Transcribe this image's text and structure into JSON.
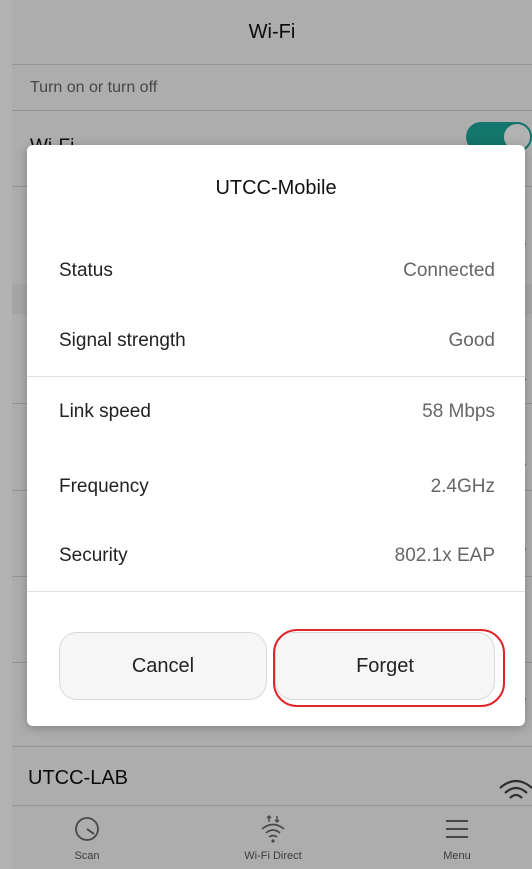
{
  "header": {
    "title": "Wi-Fi"
  },
  "section": {
    "label": "Turn on or turn off"
  },
  "wifi_toggle": {
    "label": "Wi-Fi",
    "state": "on",
    "accent_color": "#1ea89b"
  },
  "networks": [
    {
      "name": "UTCC-LAB",
      "icon": "wifi-signal-icon"
    }
  ],
  "dialog": {
    "title": "UTCC-Mobile",
    "rows": [
      {
        "label": "Status",
        "value": "Connected"
      },
      {
        "label": "Signal strength",
        "value": "Good"
      },
      {
        "label": "Link speed",
        "value": "58 Mbps"
      },
      {
        "label": "Frequency",
        "value": "2.4GHz"
      },
      {
        "label": "Security",
        "value": "802.1x EAP"
      }
    ],
    "buttons": {
      "cancel": "Cancel",
      "forget": "Forget"
    },
    "highlight_color": "#e0262a"
  },
  "bottom_nav": [
    {
      "label": "Scan",
      "icon": "scan-icon"
    },
    {
      "label": "Wi-Fi Direct",
      "icon": "wifi-direct-icon"
    },
    {
      "label": "Menu",
      "icon": "menu-icon"
    }
  ]
}
